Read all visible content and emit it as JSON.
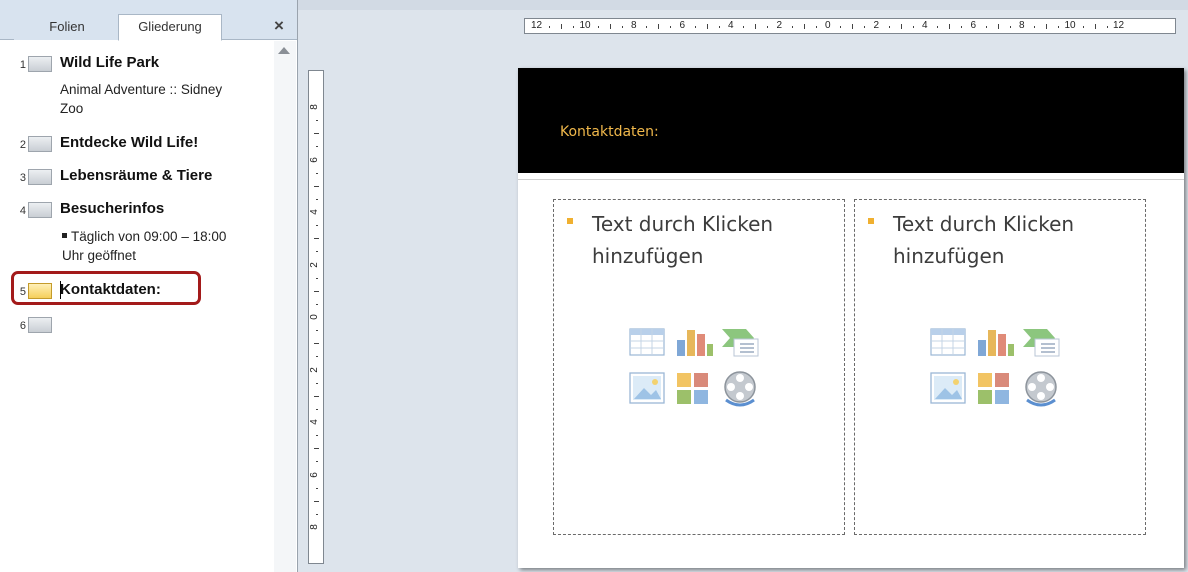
{
  "tabs": {
    "folien": "Folien",
    "gliederung": "Gliederung",
    "close": "×"
  },
  "outline": {
    "slides": [
      {
        "number": "1",
        "title": "Wild Life Park",
        "body": "Animal Adventure :: Sidney Zoo"
      },
      {
        "number": "2",
        "title": "Entdecke Wild Life!"
      },
      {
        "number": "3",
        "title": "Lebensräume & Tiere"
      },
      {
        "number": "4",
        "title": "Besucherinfos",
        "bullet": "Täglich von 09:00 – 18:00 Uhr geöffnet"
      },
      {
        "number": "5",
        "title": "Kontaktdaten:",
        "selected": true
      },
      {
        "number": "6",
        "title": ""
      }
    ]
  },
  "ruler": {
    "horizontal": [
      "12",
      "10",
      "8",
      "6",
      "4",
      "2",
      "0",
      "2",
      "4",
      "6",
      "8",
      "10",
      "12"
    ],
    "vertical": [
      "8",
      "6",
      "4",
      "2",
      "0",
      "2",
      "4",
      "6",
      "8"
    ]
  },
  "slide": {
    "title": "Kontaktdaten:",
    "placeholders": [
      {
        "text": "Text durch Klicken hinzufügen"
      },
      {
        "text": "Text durch Klicken hinzufügen"
      }
    ]
  },
  "icons": {
    "content_icons": [
      "table-icon",
      "chart-icon",
      "smartart-icon",
      "picture-icon",
      "clipart-icon",
      "media-icon"
    ]
  },
  "colors": {
    "slide_title": "#f0b84b",
    "slide_header_bg": "#000000",
    "bullet": "#f0b030",
    "selection_highlight": "#a31a1a"
  }
}
